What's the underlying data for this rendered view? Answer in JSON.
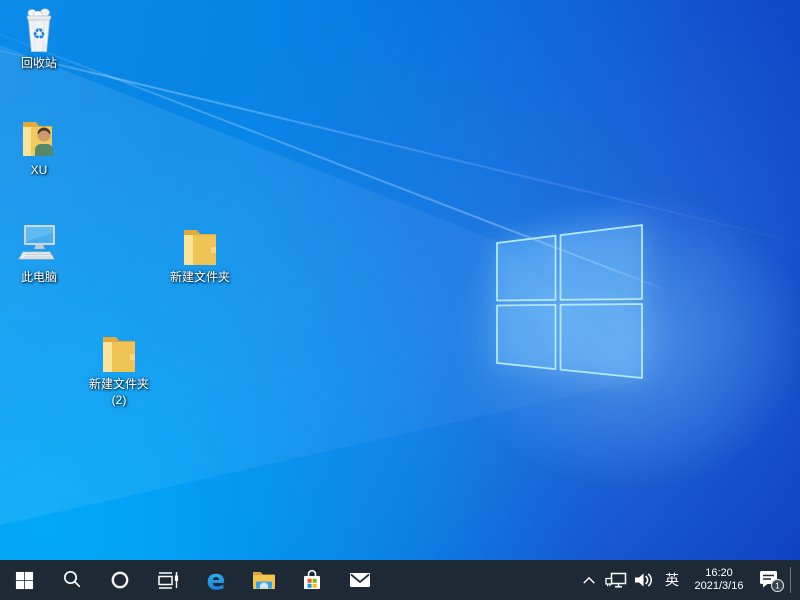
{
  "desktop": {
    "icons": [
      {
        "name": "recycle-bin",
        "label": "回收站"
      },
      {
        "name": "user-folder-xu",
        "label": "XU"
      },
      {
        "name": "this-pc",
        "label": "此电脑"
      },
      {
        "name": "new-folder",
        "label": "新建文件夹"
      },
      {
        "name": "new-folder-2",
        "label": "新建文件夹",
        "label2": "(2)"
      }
    ]
  },
  "taskbar": {
    "buttons": [
      "start",
      "search",
      "cortana",
      "task-view",
      "edge",
      "file-explorer",
      "store",
      "mail"
    ],
    "icons": {
      "edge_glyph": "e"
    },
    "tray": {
      "ime": "英",
      "time": "16:20",
      "date": "2021/3/16",
      "notification_badge": "1"
    }
  },
  "colors": {
    "taskbar_bg": "#1d2a36",
    "wallpaper_cyan": "#00aaf5",
    "wallpaper_deep_blue": "#0d3fc0",
    "logo_edge": "#b5e8ff",
    "folder_yellow": "#f3c64f",
    "store_red": "#f25022",
    "store_green": "#7fba00",
    "store_blue": "#00a4ef",
    "store_yellow": "#ffb900"
  }
}
